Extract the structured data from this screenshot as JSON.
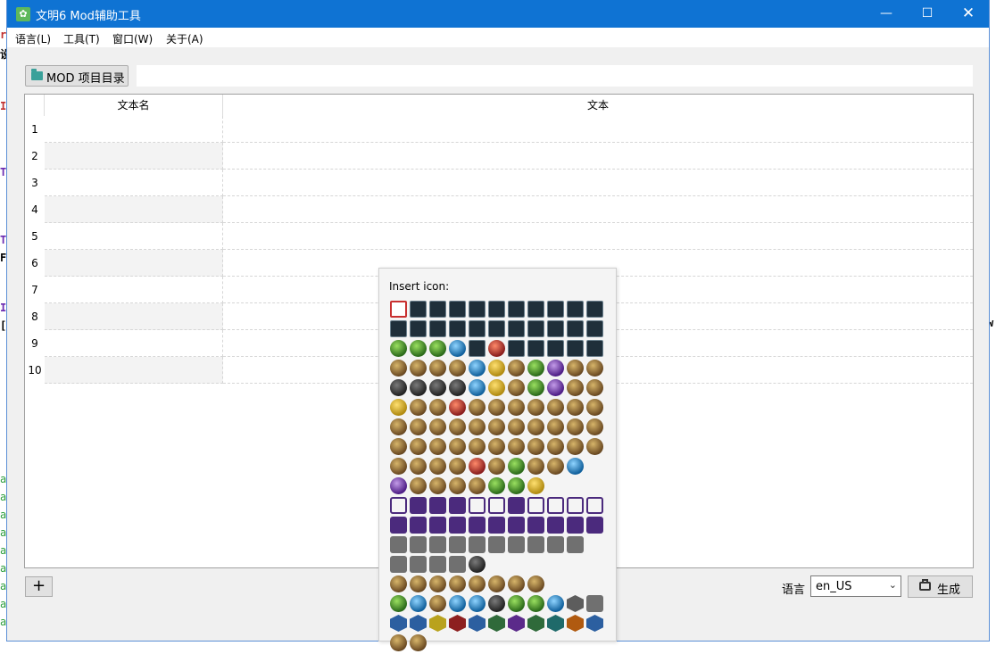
{
  "window": {
    "title": "文明6 Mod辅助工具"
  },
  "window_controls": {
    "minimize": "—",
    "maximize": "☐",
    "close": "✕"
  },
  "menu": [
    {
      "label": "语言(L)"
    },
    {
      "label": "工具(T)"
    },
    {
      "label": "窗口(W)"
    },
    {
      "label": "关于(A)"
    }
  ],
  "toolbar": {
    "mod_button_label": "MOD 项目目录",
    "path_value": ""
  },
  "table": {
    "columns": [
      "文本名",
      "文本"
    ],
    "rows": [
      {
        "num": "1",
        "name": "",
        "text": ""
      },
      {
        "num": "2",
        "name": "",
        "text": ""
      },
      {
        "num": "3",
        "name": "",
        "text": ""
      },
      {
        "num": "4",
        "name": "",
        "text": ""
      },
      {
        "num": "5",
        "name": "",
        "text": ""
      },
      {
        "num": "6",
        "name": "",
        "text": ""
      },
      {
        "num": "7",
        "name": "",
        "text": ""
      },
      {
        "num": "8",
        "name": "",
        "text": ""
      },
      {
        "num": "9",
        "name": "",
        "text": ""
      },
      {
        "num": "10",
        "name": "",
        "text": ""
      }
    ]
  },
  "bottom": {
    "add_label": "+",
    "language_label": "语言",
    "language_value": "en_US",
    "generate_label": "生成"
  },
  "icon_popup": {
    "title": "Insert icon:"
  },
  "colors": {
    "titlebar": "#0f73d3",
    "window_bg": "#f0f0f0",
    "popup_bg": "#f4f4f4",
    "selected_icon_border": "#c83030"
  }
}
